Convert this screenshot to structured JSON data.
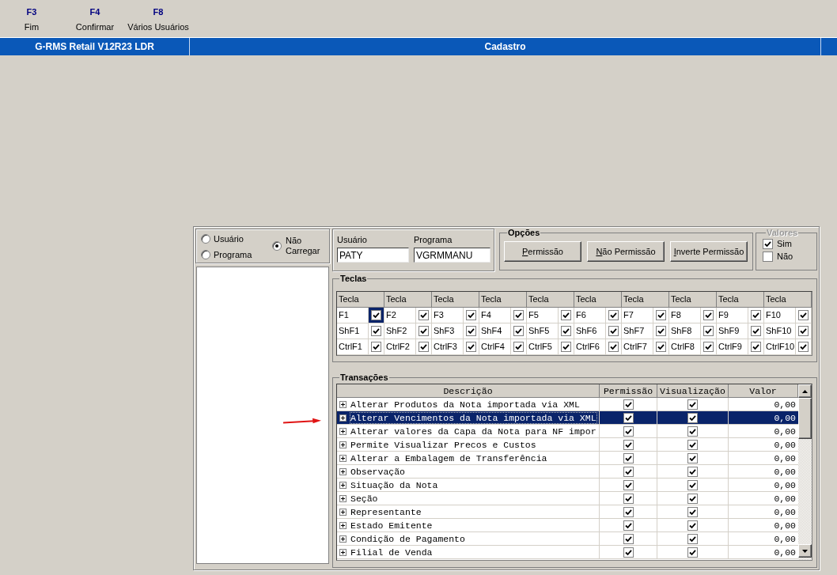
{
  "toolbar": [
    {
      "key": "F3",
      "label": "Fim"
    },
    {
      "key": "F4",
      "label": "Confirmar"
    },
    {
      "key": "F8",
      "label": "Vários Usuários"
    }
  ],
  "title_bar": {
    "app": "G-RMS Retail V12R23 LDR",
    "title": "Cadastro"
  },
  "load_options": [
    {
      "label": "Usuário",
      "selected": false
    },
    {
      "label": "Programa",
      "selected": false
    },
    {
      "label": "Não Carregar",
      "selected": true
    }
  ],
  "fields": [
    {
      "label": "Usuário",
      "value": "PATY"
    },
    {
      "label": "Programa",
      "value": "VGRMMANU"
    }
  ],
  "opcoes": {
    "title": "Opções",
    "buttons": [
      "Permissão",
      "Não Permissão",
      "Inverte Permissão"
    ]
  },
  "valores": {
    "title": "Valores",
    "disabled": true,
    "options": [
      {
        "label": "Sim",
        "checked": true
      },
      {
        "label": "Não",
        "checked": false
      }
    ]
  },
  "teclas": {
    "title": "Teclas",
    "columns": [
      "Tecla",
      "Tecla",
      "Tecla",
      "Tecla",
      "Tecla",
      "Tecla",
      "Tecla",
      "Tecla",
      "Tecla",
      "Tecla"
    ],
    "rows": [
      [
        {
          "key": "F1",
          "checked": true,
          "selected": true
        },
        {
          "key": "F2",
          "checked": true,
          "selected": false
        },
        {
          "key": "F3",
          "checked": true,
          "selected": false
        },
        {
          "key": "F4",
          "checked": true,
          "selected": false
        },
        {
          "key": "F5",
          "checked": true,
          "selected": false
        },
        {
          "key": "F6",
          "checked": true,
          "selected": false
        },
        {
          "key": "F7",
          "checked": true,
          "selected": false
        },
        {
          "key": "F8",
          "checked": true,
          "selected": false
        },
        {
          "key": "F9",
          "checked": true,
          "selected": false
        },
        {
          "key": "F10",
          "checked": true,
          "selected": false
        }
      ],
      [
        {
          "key": "ShF1",
          "checked": true,
          "selected": false
        },
        {
          "key": "ShF2",
          "checked": true,
          "selected": false
        },
        {
          "key": "ShF3",
          "checked": true,
          "selected": false
        },
        {
          "key": "ShF4",
          "checked": true,
          "selected": false
        },
        {
          "key": "ShF5",
          "checked": true,
          "selected": false
        },
        {
          "key": "ShF6",
          "checked": true,
          "selected": false
        },
        {
          "key": "ShF7",
          "checked": true,
          "selected": false
        },
        {
          "key": "ShF8",
          "checked": true,
          "selected": false
        },
        {
          "key": "ShF9",
          "checked": true,
          "selected": false
        },
        {
          "key": "ShF10",
          "checked": true,
          "selected": false
        }
      ],
      [
        {
          "key": "CtrlF1",
          "checked": true,
          "selected": false
        },
        {
          "key": "CtrlF2",
          "checked": true,
          "selected": false
        },
        {
          "key": "CtrlF3",
          "checked": true,
          "selected": false
        },
        {
          "key": "CtrlF4",
          "checked": true,
          "selected": false
        },
        {
          "key": "CtrlF5",
          "checked": true,
          "selected": false
        },
        {
          "key": "CtrlF6",
          "checked": true,
          "selected": false
        },
        {
          "key": "CtrlF7",
          "checked": true,
          "selected": false
        },
        {
          "key": "CtrlF8",
          "checked": true,
          "selected": false
        },
        {
          "key": "CtrlF9",
          "checked": true,
          "selected": false
        },
        {
          "key": "CtrlF10",
          "checked": true,
          "selected": false
        }
      ]
    ]
  },
  "transacoes": {
    "title": "Transações",
    "columns": [
      "Descrição",
      "Permissão",
      "Visualização",
      "Valor"
    ],
    "rows": [
      {
        "description": "Alterar Produtos da Nota importada via XML",
        "expanded": false,
        "permissao": true,
        "visualizacao": true,
        "valor": "0,00",
        "selected": false
      },
      {
        "description": "Alterar Vencimentos da Nota importada via XML",
        "expanded": false,
        "permissao": true,
        "visualizacao": true,
        "valor": "0,00",
        "selected": true
      },
      {
        "description": "Alterar valores da Capa da Nota para NF impor",
        "expanded": false,
        "permissao": true,
        "visualizacao": true,
        "valor": "0,00",
        "selected": false
      },
      {
        "description": "Permite Visualizar Precos e Custos",
        "expanded": false,
        "permissao": true,
        "visualizacao": true,
        "valor": "0,00",
        "selected": false
      },
      {
        "description": "Alterar a Embalagem de Transferência",
        "expanded": false,
        "permissao": true,
        "visualizacao": true,
        "valor": "0,00",
        "selected": false
      },
      {
        "description": "Observação",
        "expanded": false,
        "permissao": true,
        "visualizacao": true,
        "valor": "0,00",
        "selected": false
      },
      {
        "description": "Situação da Nota",
        "expanded": false,
        "permissao": true,
        "visualizacao": true,
        "valor": "0,00",
        "selected": false
      },
      {
        "description": "Seção",
        "expanded": false,
        "permissao": true,
        "visualizacao": true,
        "valor": "0,00",
        "selected": false
      },
      {
        "description": "Representante",
        "expanded": false,
        "permissao": true,
        "visualizacao": true,
        "valor": "0,00",
        "selected": false
      },
      {
        "description": "Estado Emitente",
        "expanded": false,
        "permissao": true,
        "visualizacao": true,
        "valor": "0,00",
        "selected": false
      },
      {
        "description": "Condição de Pagamento",
        "expanded": false,
        "permissao": true,
        "visualizacao": true,
        "valor": "0,00",
        "selected": false
      },
      {
        "description": "Filial de Venda",
        "expanded": false,
        "permissao": true,
        "visualizacao": true,
        "valor": "0,00",
        "selected": false
      }
    ]
  }
}
